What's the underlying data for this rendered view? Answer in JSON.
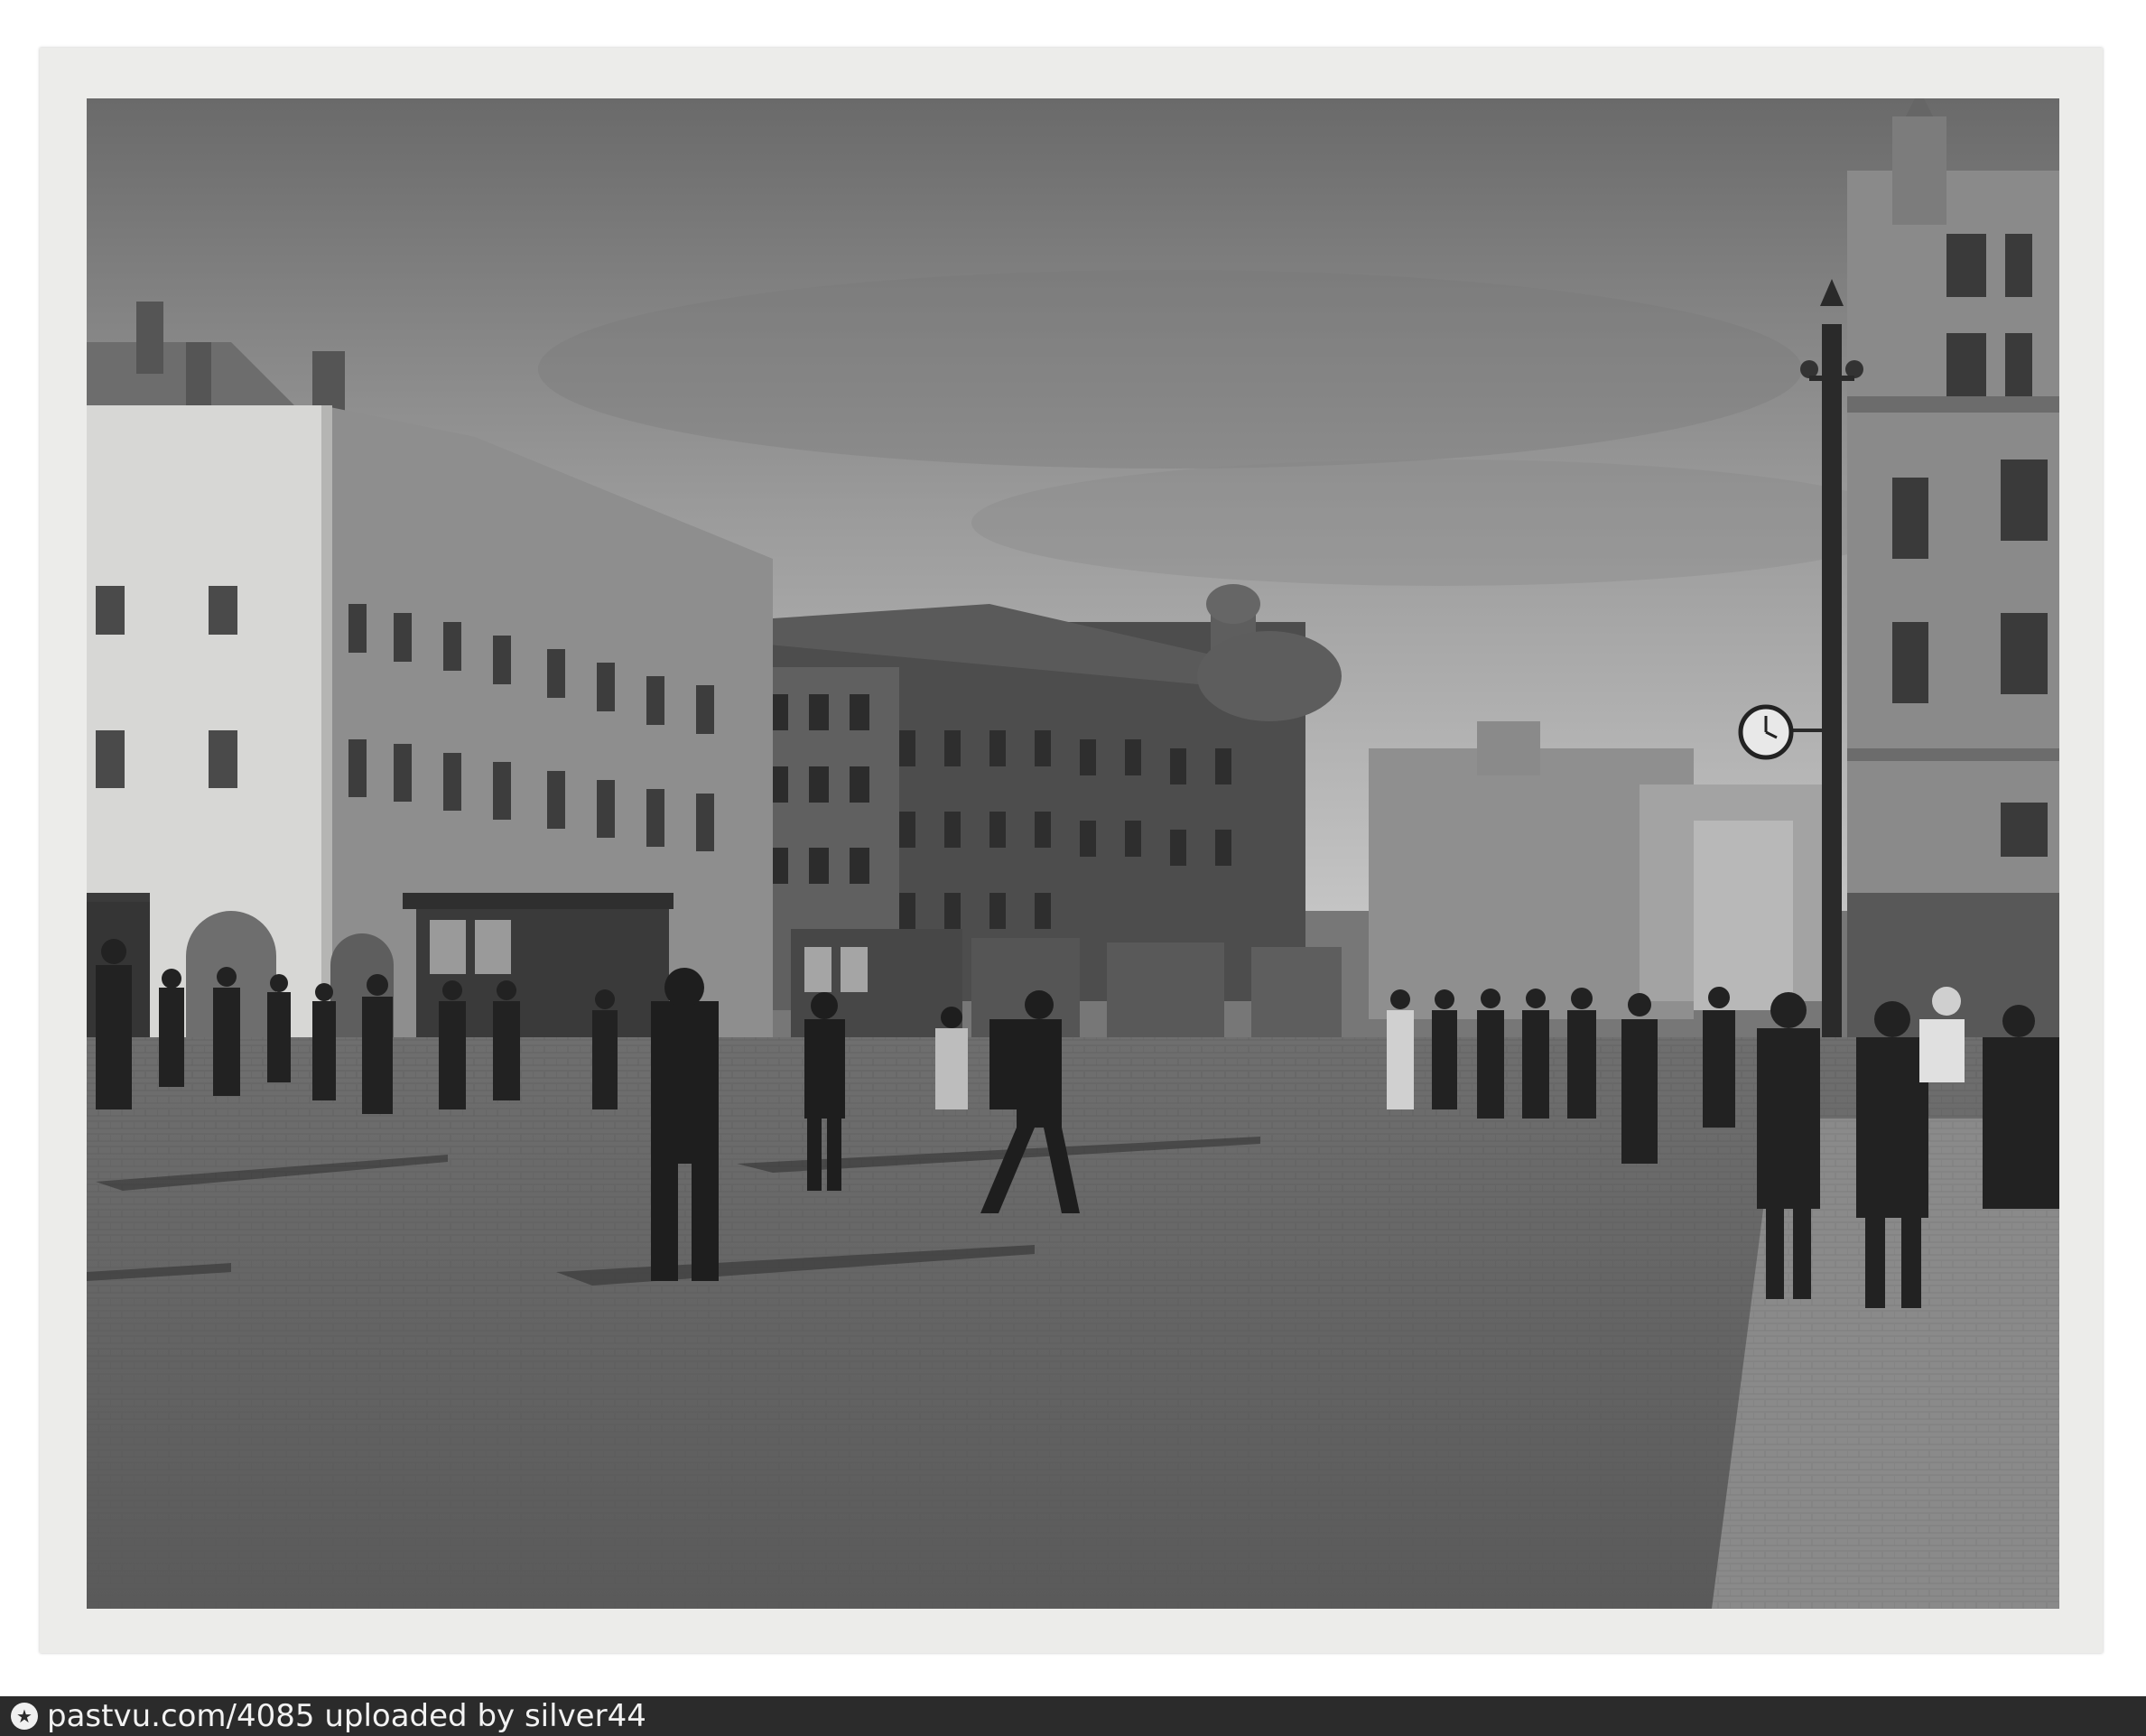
{
  "photo": {
    "icon": "clock-icon",
    "scene": "monochrome street scene"
  },
  "attribution": {
    "icon": "star-icon",
    "text": "pastvu.com/4085  uploaded by silver44",
    "bg_color": "#2b2b2b",
    "text_color": "#f2f2f2"
  }
}
